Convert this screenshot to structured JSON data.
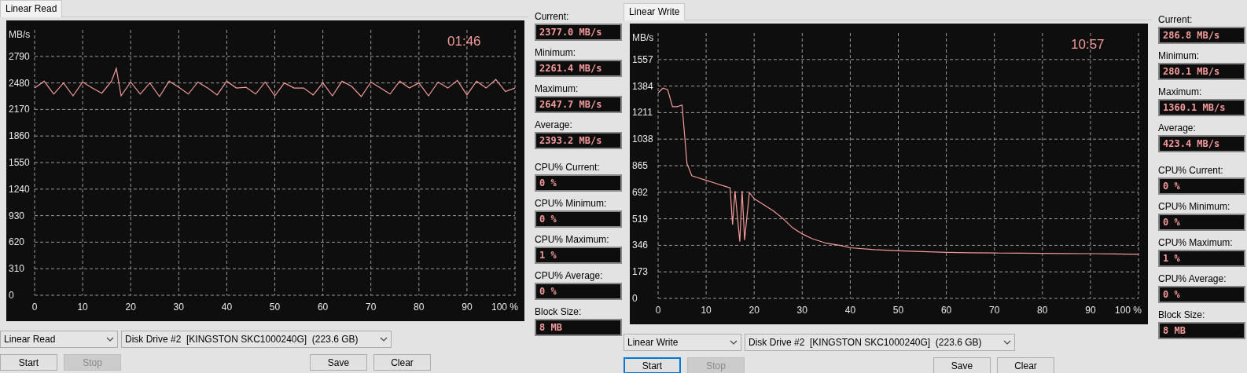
{
  "panels": [
    {
      "tab": {
        "label": "Linear Read",
        "selected": true
      },
      "timer": "01:46",
      "chart_data": {
        "type": "line",
        "grid": true,
        "ylabel": "MB/s",
        "ylim": [
          0,
          3100
        ],
        "xlim": [
          0,
          100
        ],
        "yticks": [
          0,
          310,
          620,
          930,
          1240,
          1550,
          1860,
          2170,
          2480,
          2790
        ],
        "xticks": [
          0,
          10,
          20,
          30,
          40,
          50,
          60,
          70,
          80,
          90,
          {
            "value": 100,
            "label": "100 %"
          }
        ],
        "x": [
          0,
          2,
          4,
          6,
          8,
          10,
          12,
          14,
          16,
          17,
          18,
          20,
          22,
          24,
          26,
          28,
          30,
          32,
          34,
          36,
          38,
          40,
          42,
          44,
          46,
          48,
          50,
          52,
          54,
          56,
          58,
          60,
          62,
          64,
          66,
          68,
          70,
          72,
          74,
          76,
          78,
          80,
          82,
          84,
          86,
          88,
          90,
          92,
          94,
          96,
          98,
          100
        ],
        "series": [
          {
            "color": "#f49a9a",
            "values": [
              2420,
              2500,
              2350,
              2480,
              2330,
              2490,
              2420,
              2360,
              2500,
              2650,
              2330,
              2490,
              2350,
              2480,
              2320,
              2500,
              2430,
              2350,
              2490,
              2420,
              2340,
              2500,
              2420,
              2430,
              2350,
              2490,
              2330,
              2480,
              2420,
              2420,
              2340,
              2480,
              2330,
              2500,
              2440,
              2320,
              2490,
              2420,
              2350,
              2500,
              2420,
              2480,
              2330,
              2490,
              2420,
              2510,
              2340,
              2500,
              2420,
              2520,
              2380,
              2420
            ]
          }
        ]
      },
      "stat_groups": [
        [
          {
            "label": "Current:",
            "value": "2377.0 MB/s"
          },
          {
            "label": "Minimum:",
            "value": "2261.4 MB/s"
          },
          {
            "label": "Maximum:",
            "value": "2647.7 MB/s"
          },
          {
            "label": "Average:",
            "value": "2393.2 MB/s"
          }
        ],
        [
          {
            "label": "CPU% Current:",
            "value": "0 %"
          },
          {
            "label": "CPU% Minimum:",
            "value": "0 %"
          },
          {
            "label": "CPU% Maximum:",
            "value": "1 %"
          },
          {
            "label": "CPU% Average:",
            "value": "0 %"
          },
          {
            "label": "Block Size:",
            "value": "8 MB"
          }
        ]
      ],
      "mode": "Linear Read",
      "drive": "Disk Drive #2  [KINGSTON SKC1000240G]  (223.6 GB)",
      "buttons_left": [
        {
          "label": "Start",
          "disabled": false,
          "focused": false
        },
        {
          "label": "Stop",
          "disabled": true,
          "focused": false
        }
      ],
      "buttons_right": [
        {
          "label": "Save",
          "disabled": false,
          "focused": false
        },
        {
          "label": "Clear",
          "disabled": false,
          "focused": false
        }
      ]
    },
    {
      "tab": {
        "label": "Linear Write",
        "selected": true
      },
      "timer": "10:57",
      "chart_data": {
        "type": "line",
        "grid": true,
        "ylabel": "MB/s",
        "ylim": [
          0,
          1730
        ],
        "xlim": [
          0,
          100
        ],
        "yticks": [
          0,
          173,
          346,
          519,
          692,
          865,
          1038,
          1211,
          1384,
          1557
        ],
        "xticks": [
          0,
          10,
          20,
          30,
          40,
          50,
          60,
          70,
          80,
          90,
          {
            "value": 100,
            "label": "100 %"
          }
        ],
        "x": [
          0,
          1,
          2,
          3,
          4,
          5,
          6,
          7,
          8,
          10,
          12,
          14,
          15,
          15.5,
          16,
          17,
          17.5,
          18,
          19,
          20,
          22,
          24,
          26,
          28,
          30,
          32,
          35,
          38,
          40,
          45,
          50,
          55,
          60,
          65,
          70,
          75,
          80,
          85,
          90,
          95,
          100
        ],
        "series": [
          {
            "color": "#f49a9a",
            "values": [
              1340,
              1370,
              1360,
              1250,
              1250,
              1260,
              880,
              800,
              790,
              770,
              750,
              730,
              720,
              480,
              700,
              370,
              700,
              380,
              690,
              650,
              610,
              570,
              520,
              460,
              420,
              390,
              360,
              345,
              330,
              318,
              310,
              305,
              300,
              298,
              296,
              295,
              294,
              293,
              292,
              290,
              287
            ]
          }
        ]
      },
      "stat_groups": [
        [
          {
            "label": "Current:",
            "value": "286.8 MB/s"
          },
          {
            "label": "Minimum:",
            "value": "280.1 MB/s"
          },
          {
            "label": "Maximum:",
            "value": "1360.1 MB/s"
          },
          {
            "label": "Average:",
            "value": "423.4 MB/s"
          }
        ],
        [
          {
            "label": "CPU% Current:",
            "value": "0 %"
          },
          {
            "label": "CPU% Minimum:",
            "value": "0 %"
          },
          {
            "label": "CPU% Maximum:",
            "value": "1 %"
          },
          {
            "label": "CPU% Average:",
            "value": "0 %"
          },
          {
            "label": "Block Size:",
            "value": "8 MB"
          }
        ]
      ],
      "mode": "Linear Write",
      "drive": "Disk Drive #2  [KINGSTON SKC1000240G]  (223.6 GB)",
      "buttons_left": [
        {
          "label": "Start",
          "disabled": false,
          "focused": true
        },
        {
          "label": "Stop",
          "disabled": true,
          "focused": false
        }
      ],
      "buttons_right": [
        {
          "label": "Save",
          "disabled": false,
          "focused": false
        },
        {
          "label": "Clear",
          "disabled": false,
          "focused": false
        }
      ]
    }
  ]
}
